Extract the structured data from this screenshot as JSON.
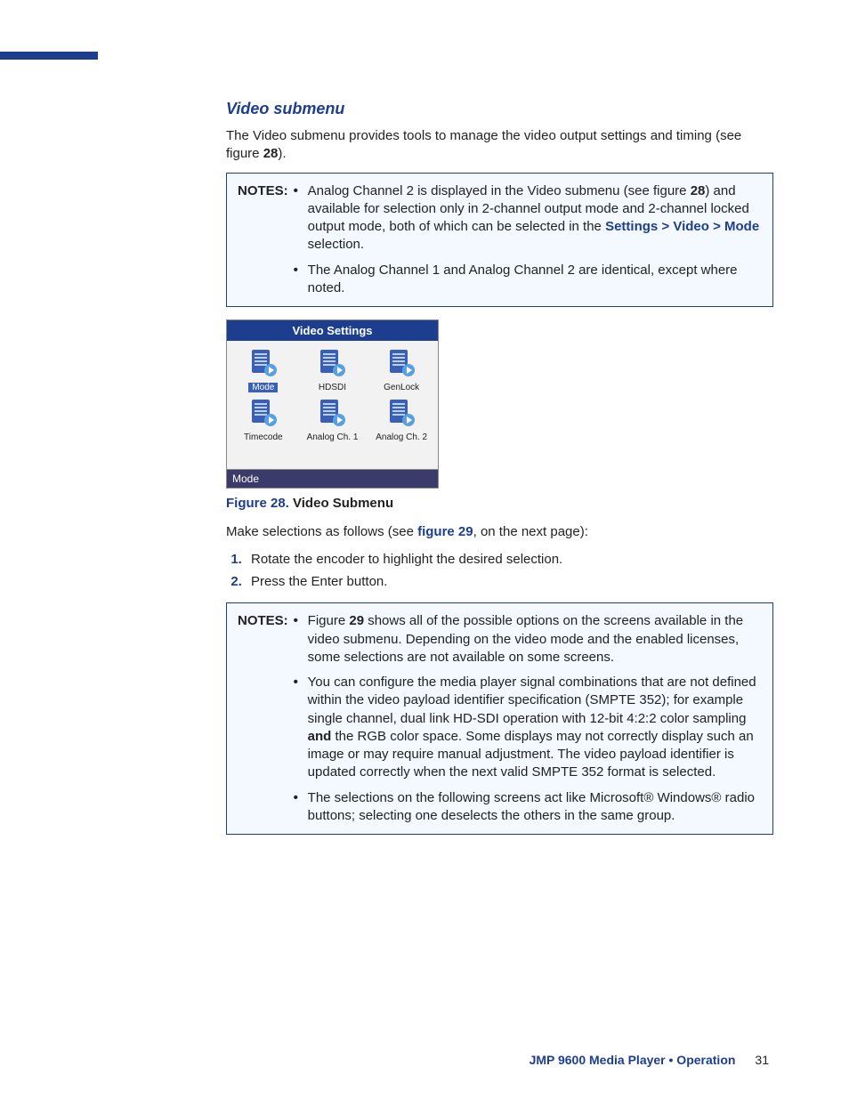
{
  "heading": "Video submenu",
  "intro": {
    "pre": "The Video submenu provides tools to manage the video output settings and timing (see figure ",
    "bold": "28",
    "post": ")."
  },
  "notes1": {
    "label": "NOTES:",
    "items": [
      {
        "t1": "Analog Channel 2 is displayed in the Video submenu (see figure ",
        "b1": "28",
        "t2": ") and available for selection only in 2-channel output mode and 2-channel locked output mode, both of which can be selected in the ",
        "link": "Settings > Video > Mode",
        "t3": " selection."
      },
      {
        "t1": "The Analog Channel 1 and Analog Channel 2 are identical, except where noted."
      }
    ]
  },
  "figure28": {
    "panel_title": "Video Settings",
    "icons": [
      "Mode",
      "HDSDI",
      "GenLock",
      "Timecode",
      "Analog Ch. 1",
      "Analog Ch. 2"
    ],
    "status": "Mode",
    "caption_num": "Figure 28.",
    "caption_title": "Video Submenu"
  },
  "make_sel": {
    "pre": "Make selections as follows (see ",
    "link": "figure 29",
    "post": ", on the next page):"
  },
  "steps": [
    "Rotate the encoder to highlight the desired selection.",
    "Press the Enter button."
  ],
  "notes2": {
    "label": "NOTES:",
    "items": [
      {
        "t1": "Figure ",
        "b1": "29",
        "t2": " shows all of the possible options on the screens available in the video submenu. Depending on the video mode and the enabled licenses, some selections are not available on some screens."
      },
      {
        "t1": "You can configure the media player signal combinations that are not defined within the video payload identifier specification (SMPTE 352); for example single channel, dual link HD-SDI operation with 12-bit 4:2:2 color sampling ",
        "b1": "and",
        "t2": " the RGB color space. Some displays may not correctly display such an image or may require manual adjustment. The video payload identifier is updated correctly when the next valid SMPTE 352 format is selected."
      },
      {
        "t1": "The selections on the following screens act like Microsoft® Windows® radio buttons; selecting one deselects the others in the same group."
      }
    ]
  },
  "footer": {
    "title": "JMP 9600 Media Player • Operation",
    "page": "31"
  }
}
